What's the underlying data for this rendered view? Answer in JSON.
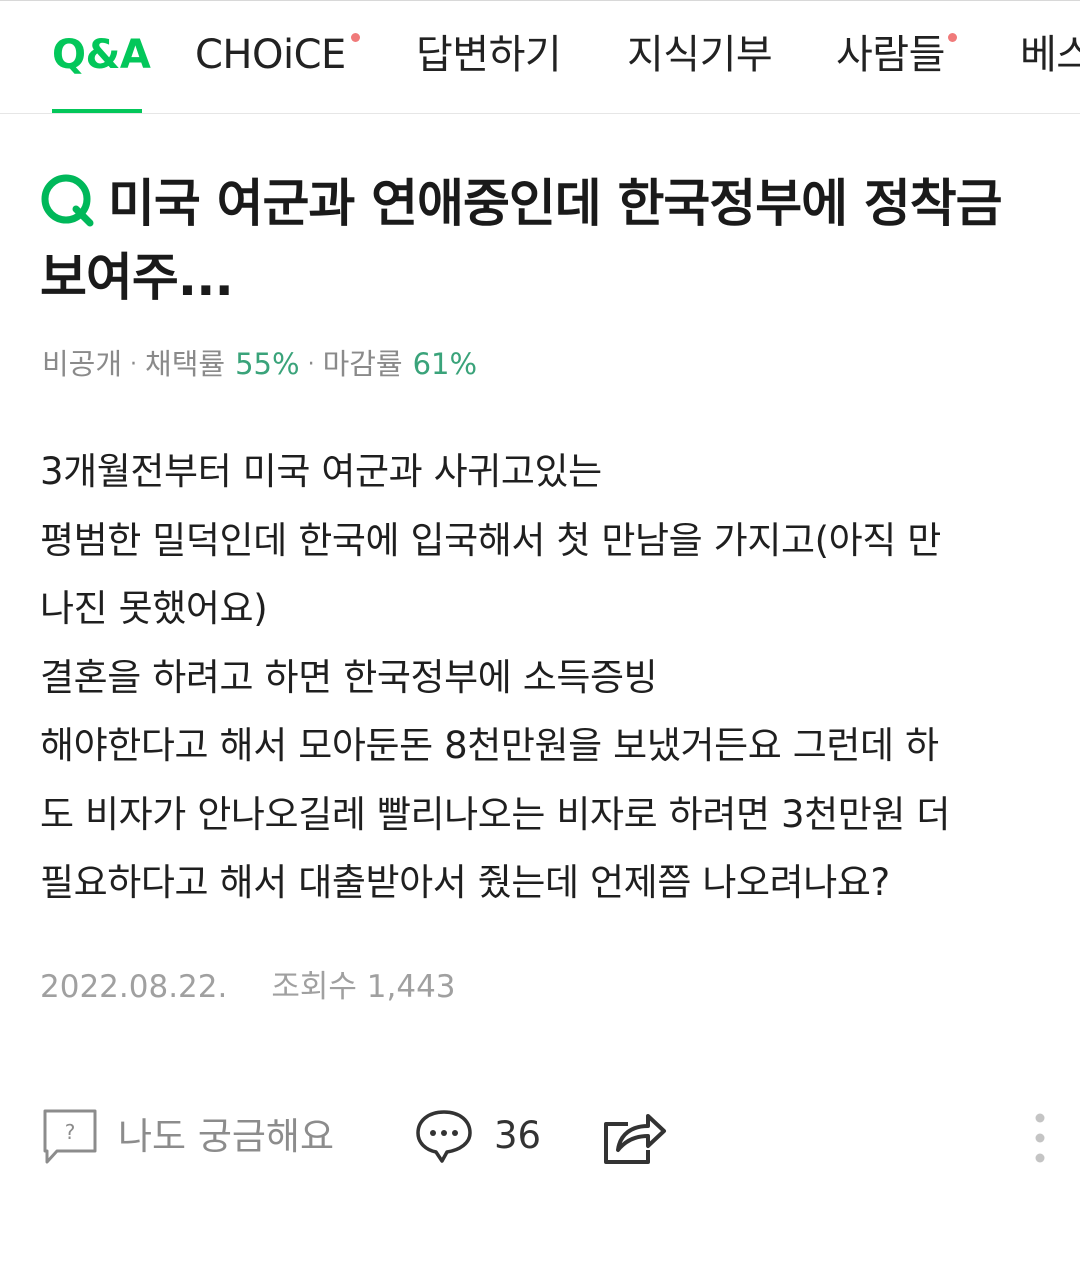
{
  "colors": {
    "accent": "#03c75a",
    "title_icon": "#00b85a",
    "notify_dot": "#f07a7a",
    "stat_value": "#3aa37a",
    "muted": "#8a8a8a",
    "icon_gray": "#555555"
  },
  "tabs": [
    {
      "label": "Q&A",
      "active": true,
      "dot": false
    },
    {
      "label": "CHOiCE",
      "active": false,
      "dot": true
    },
    {
      "label": "답변하기",
      "active": false,
      "dot": false
    },
    {
      "label": "지식기부",
      "active": false,
      "dot": false
    },
    {
      "label": "사람들",
      "active": false,
      "dot": true
    },
    {
      "label": "베스",
      "active": false,
      "dot": false
    }
  ],
  "question": {
    "title": "미국 여군과 연애중인데 한국정부에 정착금 보여주...",
    "privacy": "비공개",
    "adopt_label": "채택률",
    "adopt_rate": "55%",
    "close_label": "마감률",
    "close_rate": "61%",
    "body_lines": [
      "3개월전부터 미국 여군과 사귀고있는",
      "평범한 밀덕인데 한국에 입국해서 첫 만남을 가지고(아직 만",
      "나진 못했어요)",
      "결혼을 하려고 하면 한국정부에 소득증빙",
      "해야한다고 해서 모아둔돈 8천만원을 보냈거든요 그런데 하",
      "도 비자가 안나오길레 빨리나오는 비자로 하려면 3천만원 더",
      "필요하다고 해서 대출받아서 줬는데 언제쯤 나오려나요?"
    ],
    "date": "2022.08.22.",
    "views_label": "조회수",
    "views": "1,443"
  },
  "actions": {
    "curious_label": "나도 궁금해요",
    "curious_icon": "question-bubble-icon",
    "comment_icon": "speech-bubble-icon",
    "comment_count": "36",
    "share_icon": "share-icon",
    "more_icon": "more-vertical-icon"
  }
}
